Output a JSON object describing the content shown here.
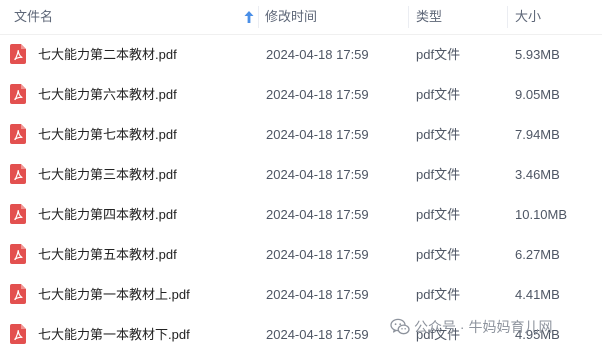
{
  "columns": {
    "name": "文件名",
    "modified": "修改时间",
    "type": "类型",
    "size": "大小"
  },
  "sort_icon": "arrow-up-icon",
  "file_icon": "pdf-icon",
  "accent_color": "#4a8fe7",
  "pdf_icon_color": "#e3504f",
  "files": [
    {
      "name": "七大能力第二本教材.pdf",
      "modified": "2024-04-18 17:59",
      "type": "pdf文件",
      "size": "5.93MB"
    },
    {
      "name": "七大能力第六本教材.pdf",
      "modified": "2024-04-18 17:59",
      "type": "pdf文件",
      "size": "9.05MB"
    },
    {
      "name": "七大能力第七本教材.pdf",
      "modified": "2024-04-18 17:59",
      "type": "pdf文件",
      "size": "7.94MB"
    },
    {
      "name": "七大能力第三本教材.pdf",
      "modified": "2024-04-18 17:59",
      "type": "pdf文件",
      "size": "3.46MB"
    },
    {
      "name": "七大能力第四本教材.pdf",
      "modified": "2024-04-18 17:59",
      "type": "pdf文件",
      "size": "10.10MB"
    },
    {
      "name": "七大能力第五本教材.pdf",
      "modified": "2024-04-18 17:59",
      "type": "pdf文件",
      "size": "6.27MB"
    },
    {
      "name": "七大能力第一本教材上.pdf",
      "modified": "2024-04-18 17:59",
      "type": "pdf文件",
      "size": "4.41MB"
    },
    {
      "name": "七大能力第一本教材下.pdf",
      "modified": "2024-04-18 17:59",
      "type": "pdf文件",
      "size": "4.95MB"
    }
  ],
  "watermark": {
    "text": "公众号 · 牛妈妈育儿网",
    "icon": "wechat-icon"
  }
}
